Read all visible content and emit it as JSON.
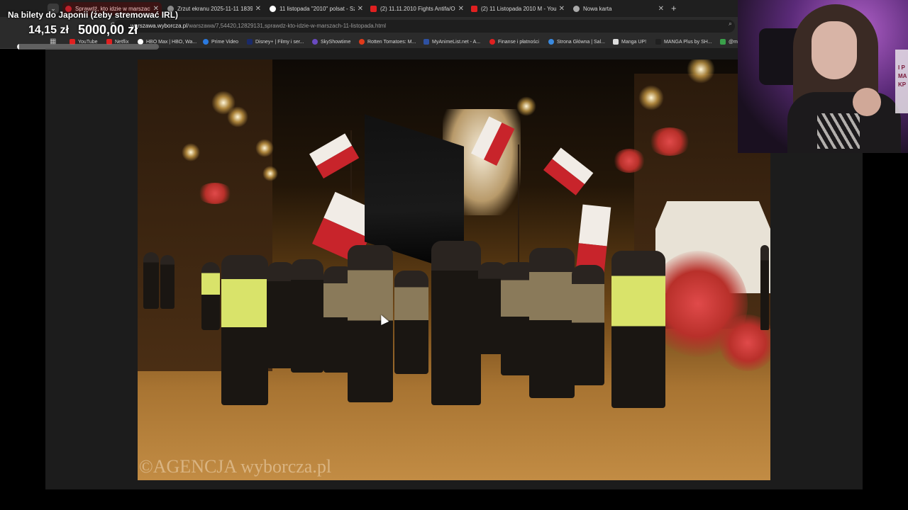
{
  "tabs": [
    {
      "title": "Sprawdź, kto idzie w marszach",
      "active": true,
      "favicon_color": "#c0202a"
    },
    {
      "title": "Zrzut ekranu 2025-11-11 1839",
      "active": false,
      "favicon_color": "#8a8a8a"
    },
    {
      "title": "11 listopada \"2010\" polsat - Sz",
      "active": false,
      "favicon_color": "#ffffff"
    },
    {
      "title": "(2) 11.11.2010 Fights Antifa/ON",
      "active": false,
      "favicon_color": "#e02020"
    },
    {
      "title": "(2) 11 Listopada 2010 M - YouT",
      "active": false,
      "favicon_color": "#e02020"
    },
    {
      "title": "Nowa karta",
      "active": false,
      "favicon_color": "#aaaaaa"
    }
  ],
  "addressbar": {
    "url_host": "warszawa.wyborcza.pl",
    "url_path": "/warszawa/7,54420,12829131,sprawdz-kto-idzie-w-marszach-11-listopada.html"
  },
  "bookmarks": [
    {
      "label": "YouTube",
      "color": "#e02020"
    },
    {
      "label": "Netflix",
      "color": "#e02020"
    },
    {
      "label": "HBO Max | HBO, Wa...",
      "color": "#ffffff"
    },
    {
      "label": "Prime Video",
      "color": "#2a7ae0"
    },
    {
      "label": "Disney+ | Filmy i ser...",
      "color": "#1a2a6a"
    },
    {
      "label": "SkyShowtime",
      "color": "#6a4ac0"
    },
    {
      "label": "Rotten Tomatoes: M...",
      "color": "#e03a1a"
    },
    {
      "label": "MyAnimeList.net - A...",
      "color": "#2e51a2"
    },
    {
      "label": "Finanse i płatności",
      "color": "#e02020"
    },
    {
      "label": "Strona Główna | Sal...",
      "color": "#3a8ae0"
    },
    {
      "label": "Manga UP!",
      "color": "#dddddd"
    },
    {
      "label": "MANGA Plus by SH...",
      "color": "#202020"
    },
    {
      "label": "@m",
      "color": "#3aa04a"
    }
  ],
  "overlay": {
    "goal_title": "Na bilety do Japonii (żeby stremować IRL)",
    "current_amount": "14,15 zł",
    "goal_amount": "5000,00 zł",
    "progress_fraction": 0.0028
  },
  "photo": {
    "watermark": "©AGENCJA wyborcza.pl"
  },
  "webcam": {
    "poster_text": "I P\nMA\nKP"
  }
}
